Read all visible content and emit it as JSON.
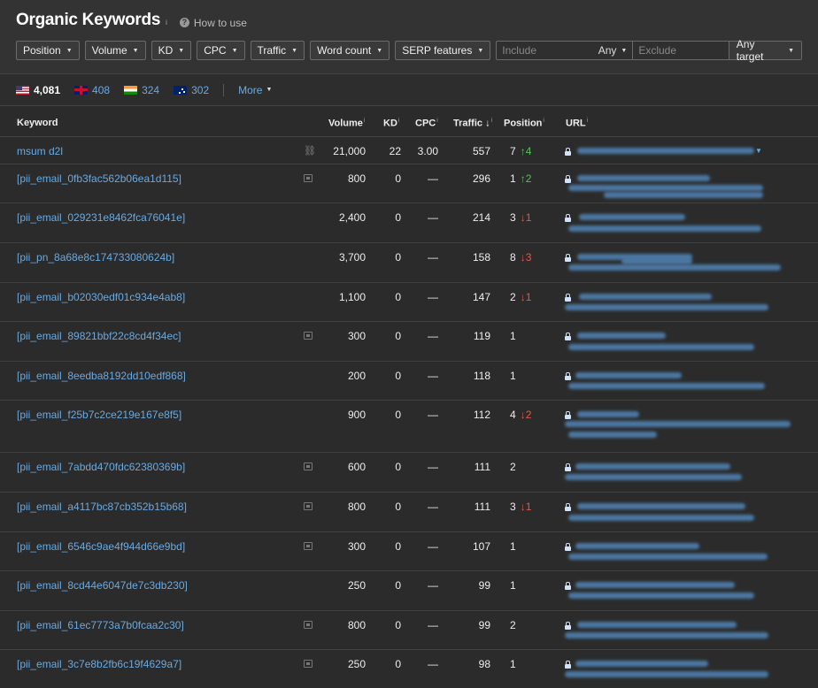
{
  "header": {
    "title": "Organic Keywords",
    "title_info": "i",
    "howto_label": "How to use"
  },
  "filters": {
    "position": "Position",
    "volume": "Volume",
    "kd": "KD",
    "cpc": "CPC",
    "traffic": "Traffic",
    "word_count": "Word count",
    "serp_features": "SERP features",
    "include_placeholder": "Include",
    "any_label": "Any",
    "exclude_placeholder": "Exclude",
    "target_label": "Any target"
  },
  "countries": [
    {
      "code": "us",
      "count": "4,081"
    },
    {
      "code": "gb",
      "count": "408"
    },
    {
      "code": "in",
      "count": "324"
    },
    {
      "code": "au",
      "count": "302"
    }
  ],
  "more_label": "More",
  "table": {
    "columns": {
      "keyword": "Keyword",
      "volume": "Volume",
      "kd": "KD",
      "cpc": "CPC",
      "traffic": "Traffic ↓",
      "position": "Position",
      "url": "URL"
    },
    "rows": [
      {
        "keyword": "msum d2l",
        "icon": "link-icon",
        "volume": "21,000",
        "kd": "22",
        "cpc": "3.00",
        "traffic": "557",
        "position": "7",
        "delta": "↑4",
        "trend": "up"
      },
      {
        "keyword": "[pii_email_0fb3fac562b06ea1d115]",
        "icon": "serp-icon",
        "volume": "800",
        "kd": "0",
        "cpc": "—",
        "traffic": "296",
        "position": "1",
        "delta": "↑2",
        "trend": "up"
      },
      {
        "keyword": "[pii_email_029231e8462fca76041e]",
        "icon": "",
        "volume": "2,400",
        "kd": "0",
        "cpc": "—",
        "traffic": "214",
        "position": "3",
        "delta": "↓1",
        "trend": "down"
      },
      {
        "keyword": "[pii_pn_8a68e8c174733080624b]",
        "icon": "",
        "volume": "3,700",
        "kd": "0",
        "cpc": "—",
        "traffic": "158",
        "position": "8",
        "delta": "↓3",
        "trend": "down"
      },
      {
        "keyword": "[pii_email_b02030edf01c934e4ab8]",
        "icon": "",
        "volume": "1,100",
        "kd": "0",
        "cpc": "—",
        "traffic": "147",
        "position": "2",
        "delta": "↓1",
        "trend": "down"
      },
      {
        "keyword": "[pii_email_89821bbf22c8cd4f34ec]",
        "icon": "serp-icon",
        "volume": "300",
        "kd": "0",
        "cpc": "—",
        "traffic": "119",
        "position": "1",
        "delta": "",
        "trend": ""
      },
      {
        "keyword": "[pii_email_8eedba8192dd10edf868]",
        "icon": "",
        "volume": "200",
        "kd": "0",
        "cpc": "—",
        "traffic": "118",
        "position": "1",
        "delta": "",
        "trend": ""
      },
      {
        "keyword": "[pii_email_f25b7c2ce219e167e8f5]",
        "icon": "",
        "volume": "900",
        "kd": "0",
        "cpc": "—",
        "traffic": "112",
        "position": "4",
        "delta": "↓2",
        "trend": "down"
      },
      {
        "keyword": "[pii_email_7abdd470fdc62380369b]",
        "icon": "serp-icon",
        "volume": "600",
        "kd": "0",
        "cpc": "—",
        "traffic": "111",
        "position": "2",
        "delta": "",
        "trend": ""
      },
      {
        "keyword": "[pii_email_a4117bc87cb352b15b68]",
        "icon": "serp-icon",
        "volume": "800",
        "kd": "0",
        "cpc": "—",
        "traffic": "111",
        "position": "3",
        "delta": "↓1",
        "trend": "down"
      },
      {
        "keyword": "[pii_email_6546c9ae4f944d66e9bd]",
        "icon": "serp-icon",
        "volume": "300",
        "kd": "0",
        "cpc": "—",
        "traffic": "107",
        "position": "1",
        "delta": "",
        "trend": ""
      },
      {
        "keyword": "[pii_email_8cd44e6047de7c3db230]",
        "icon": "",
        "volume": "250",
        "kd": "0",
        "cpc": "—",
        "traffic": "99",
        "position": "1",
        "delta": "",
        "trend": ""
      },
      {
        "keyword": "[pii_email_61ec7773a7b0fcaa2c30]",
        "icon": "serp-icon",
        "volume": "800",
        "kd": "0",
        "cpc": "—",
        "traffic": "99",
        "position": "2",
        "delta": "",
        "trend": ""
      },
      {
        "keyword": "[pii_email_3c7e8b2fb6c19f4629a7]",
        "icon": "serp-icon",
        "volume": "250",
        "kd": "0",
        "cpc": "—",
        "traffic": "98",
        "position": "1",
        "delta": "",
        "trend": ""
      }
    ]
  }
}
